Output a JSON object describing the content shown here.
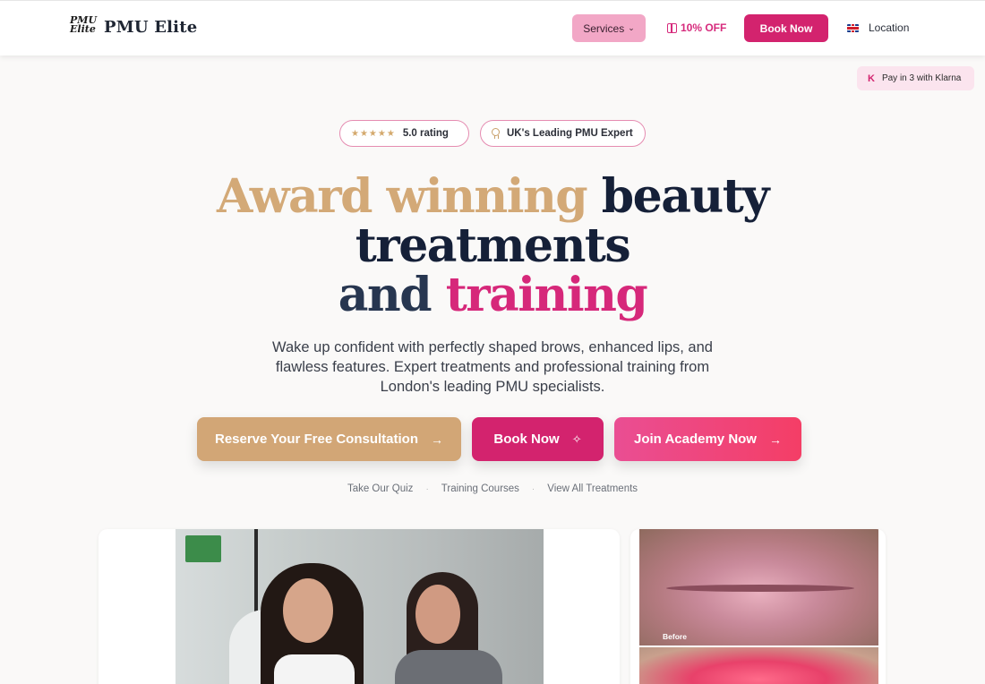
{
  "header": {
    "logo_mark": "PMU Elite",
    "brand": "PMU Elite",
    "nav": {
      "services_label": "Services",
      "offer_label": "10% OFF",
      "book_label": "Book Now",
      "location_label": "Location"
    }
  },
  "klarna": {
    "badge_letter": "K",
    "text": "Pay in 3 with Klarna"
  },
  "pills": {
    "rating": {
      "stars": "★★★★★",
      "label": "5.0 rating",
      "star_count": 5
    },
    "expert_label": "UK's Leading PMU Expert"
  },
  "hero": {
    "headline_part1": "Award winning",
    "headline_part2": "beauty treatments",
    "headline_part3": "and",
    "headline_part4": "training",
    "subtext": "Wake up confident with perfectly shaped brows, enhanced lips, and flawless features. Expert treatments and professional training from London's leading PMU specialists."
  },
  "cta": {
    "consult_label": "Reserve Your Free Consultation",
    "book_label": "Book Now",
    "academy_label": "Join Academy Now"
  },
  "links": {
    "items": [
      "Take Our Quiz",
      "Training Courses",
      "View All Treatments"
    ],
    "separator": "·"
  },
  "gallery": {
    "before_label": "Before"
  },
  "colors": {
    "brand_pink": "#d3236e",
    "gold": "#d2a676",
    "services_bg": "#f2a7c6",
    "navy": "#152038"
  },
  "icons": {
    "gift": "gift-icon",
    "flag": "uk-flag-icon",
    "award": "award-icon",
    "arrow": "→",
    "sparkle": "✧"
  }
}
